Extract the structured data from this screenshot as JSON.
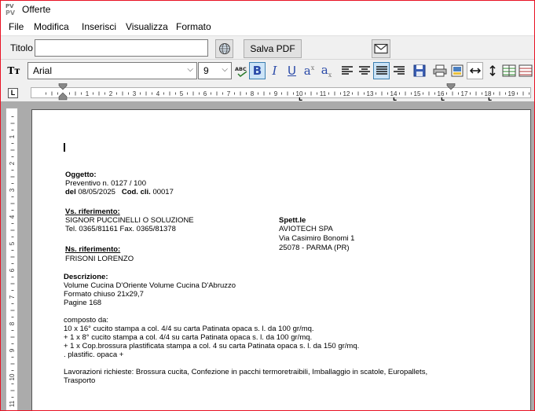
{
  "window": {
    "app_icon": "PV",
    "title": "Offerte"
  },
  "menu": [
    "File",
    "Modifica",
    "Inserisci",
    "Visualizza",
    "Formato"
  ],
  "titlerow": {
    "label": "Titolo",
    "value": "",
    "save_pdf": "Salva PDF"
  },
  "format": {
    "font": "Arial",
    "size": "9",
    "font_icon": "Tт"
  },
  "ruler": {
    "numbers": [
      "1",
      "2",
      "3",
      "4",
      "5",
      "6",
      "7",
      "8",
      "9",
      "10",
      "11",
      "12",
      "13",
      "14",
      "15",
      "16",
      "17",
      "18",
      "19"
    ]
  },
  "vruler": {
    "numbers": [
      "1",
      "2",
      "3",
      "4",
      "5",
      "6",
      "7",
      "8",
      "9",
      "10",
      "11"
    ]
  },
  "document": {
    "oggetto_label": "Oggetto:",
    "preventivo": "Preventivo n. 0127 /  100",
    "del_label": "del",
    "del_date": "08/05/2025",
    "cod_label": "Cod. cli.",
    "cod_value": "00017",
    "vs_rif_label": "Vs. riferimento:",
    "vs_rif_name": "SIGNOR PUCCINELLI O SOLUZIONE",
    "vs_rif_tel": "Tel. 0365/81161   Fax. 0365/81378",
    "ns_rif_label": "Ns. riferimento:",
    "ns_rif_name": "FRISONI LORENZO",
    "spett_label": "Spett.le",
    "spett_name": "AVIOTECH SPA",
    "spett_addr1": "Via Casimiro Bonomi 1",
    "spett_addr2": "25078 - PARMA (PR)",
    "descr_label": "Descrizione:",
    "descr_line1": "Volume Cucina D'Oriente Volume Cucina D'Abruzzo",
    "descr_line2": "Formato chiuso 21x29,7",
    "descr_line3": "Pagine 168",
    "composto": "composto da:",
    "comp1": "10 x 16° cucito  stampa a col. 4/4  su carta Patinata opaca s. l. da 100 gr/mq.",
    "comp2": " + 1 x 8° cucito  stampa a col. 4/4  su carta Patinata opaca s. l. da 100 gr/mq.",
    "comp3": " + 1 x Cop.brossura plastificata  stampa a col. 4 su carta Patinata opaca s. l. da 150 gr/mq.",
    "comp4": ". plastific. opaca +",
    "lavorazioni1": "Lavorazioni richieste: Brossura cucita, Confezione in pacchi termoretraibili, Imballaggio in scatole, Europallets,",
    "lavorazioni2": "Trasporto"
  }
}
